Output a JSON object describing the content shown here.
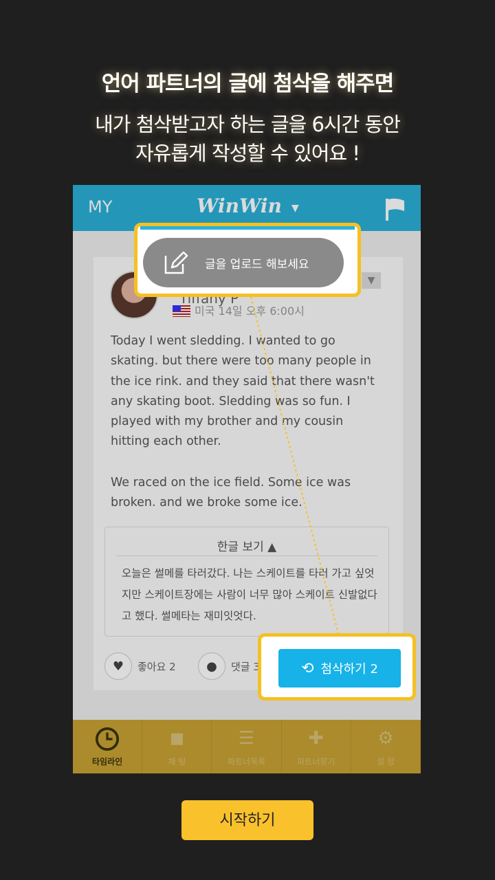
{
  "header": {
    "headline": "언어 파트너의 글에 첨삭을 해주면",
    "line1": "내가 첨삭받고자 하는  글을 6시간 동안",
    "line2": "자유롭게  작성할 수  있어요 !"
  },
  "app": {
    "topbar": {
      "my_label": "MY",
      "logo": "WinWin",
      "caret": "▼",
      "bg_color": "#2bb0d8"
    },
    "post": {
      "username": "Tiffany P",
      "meta": "미국 14일 오후 6:00시",
      "paragraph1": "Today I went sledding. I wanted to go skating. but there were too many people in the ice rink. and they said that there wasn't any skating boot. Sledding was so fun. I played with my brother and my cousin hitting each other.",
      "paragraph2": "We raced on the ice field. Some ice was broken. and we broke some ice.",
      "translation_toggle": "한글 보기  ▲",
      "translation": "오늘은 썰메를 타러갔다. 나는 스케이트를 타러 가고 싶엇지만 스케이트장에는 사람이 너무 많아 스케이트 신발없다고 했다. 썰메타는 재미잇엇다.",
      "like_label": "좋아요 2",
      "comment_label": "댓글 3",
      "correction_button": "첨삭하기 2"
    },
    "upload_prompt": "글을 업로드 해보세요",
    "tabs": [
      {
        "label": "타임라인",
        "icon": "clock-icon"
      },
      {
        "label": "채  팅",
        "icon": "chat-icon"
      },
      {
        "label": "파트너목록",
        "icon": "partner-list-icon"
      },
      {
        "label": "파트너찾기",
        "icon": "add-partner-icon"
      },
      {
        "label": "설  정",
        "icon": "gear-icon"
      }
    ],
    "highlight_color": "#f5c024",
    "accent_color": "#16b2e8"
  },
  "start_button": "시작하기"
}
